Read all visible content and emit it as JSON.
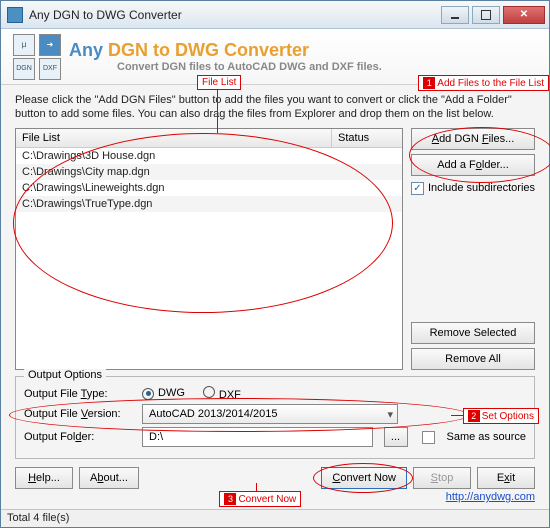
{
  "window": {
    "title": "Any DGN to DWG Converter"
  },
  "banner": {
    "prefix": "Any",
    "title": "DGN to DWG Converter",
    "subtitle": "Convert DGN files to AutoCAD DWG and DXF files."
  },
  "annotations": {
    "filelist": "File List",
    "step1": "Add Files to the File List",
    "step2": "Set Options",
    "step3": "Convert Now"
  },
  "instructions": "Please click the \"Add DGN Files\" button to add the files you want to convert or click the \"Add a Folder\" button to add some files. You can also drag the files from Explorer and drop them on the list below.",
  "list": {
    "col_file": "File List",
    "col_status": "Status",
    "rows": [
      "C:\\Drawings\\3D House.dgn",
      "C:\\Drawings\\City map.dgn",
      "C:\\Drawings\\Lineweights.dgn",
      "C:\\Drawings\\TrueType.dgn"
    ]
  },
  "side": {
    "add_files": "Add DGN Files...",
    "add_folder": "Add a Folder...",
    "include_sub": "Include subdirectories",
    "remove_selected": "Remove Selected",
    "remove_all": "Remove All"
  },
  "output": {
    "legend": "Output Options",
    "type_label": "Output File Type:",
    "type_dwg": "DWG",
    "type_dxf": "DXF",
    "version_label": "Output File Version:",
    "version_value": "AutoCAD 2013/2014/2015",
    "folder_label": "Output Folder:",
    "folder_value": "D:\\",
    "browse": "...",
    "same_as_source": "Same as source"
  },
  "bottom": {
    "help": "Help...",
    "about": "About...",
    "convert": "Convert Now",
    "stop": "Stop",
    "exit": "Exit",
    "link": "http://anydwg.com"
  },
  "statusbar": "Total 4 file(s)"
}
